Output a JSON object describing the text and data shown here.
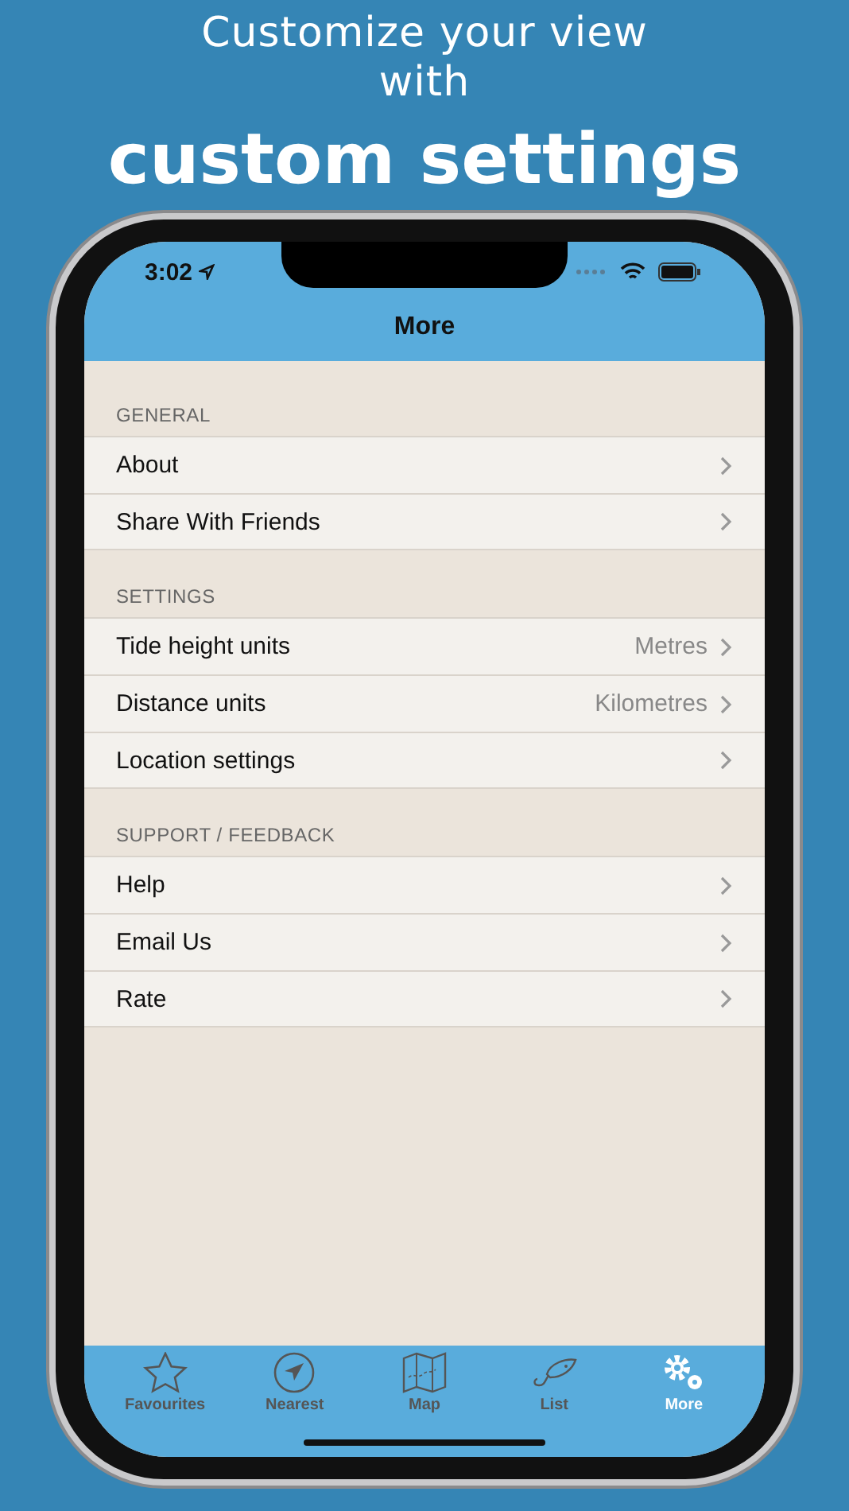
{
  "headline": {
    "line1": "Customize your view",
    "line2": "with",
    "emphasis": "custom settings"
  },
  "status_bar": {
    "time": "3:02"
  },
  "nav": {
    "title": "More"
  },
  "sections": [
    {
      "header": "GENERAL",
      "rows": [
        {
          "label": "About"
        },
        {
          "label": "Share With Friends"
        }
      ]
    },
    {
      "header": "SETTINGS",
      "rows": [
        {
          "label": "Tide height units",
          "value": "Metres"
        },
        {
          "label": "Distance units",
          "value": "Kilometres"
        },
        {
          "label": "Location settings"
        }
      ]
    },
    {
      "header": "SUPPORT / FEEDBACK",
      "rows": [
        {
          "label": "Help"
        },
        {
          "label": "Email Us"
        },
        {
          "label": "Rate"
        }
      ]
    }
  ],
  "tabs": [
    {
      "label": "Favourites",
      "selected": false
    },
    {
      "label": "Nearest",
      "selected": false
    },
    {
      "label": "Map",
      "selected": false
    },
    {
      "label": "List",
      "selected": false
    },
    {
      "label": "More",
      "selected": true
    }
  ]
}
